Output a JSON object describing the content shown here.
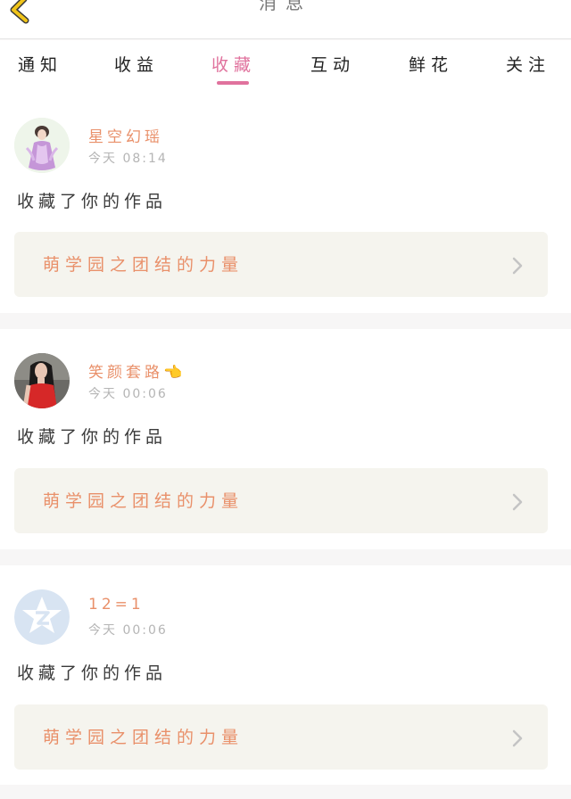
{
  "header": {
    "title": "消息",
    "back_icon": "chevron-left-icon",
    "accent_color": "#f0c419"
  },
  "tabs": [
    {
      "label": "通知",
      "active": false
    },
    {
      "label": "收益",
      "active": false
    },
    {
      "label": "收藏",
      "active": true
    },
    {
      "label": "互动",
      "active": false
    },
    {
      "label": "鲜花",
      "active": false
    },
    {
      "label": "关注",
      "active": false
    }
  ],
  "colors": {
    "active_tab": "#e0729d",
    "username": "#e9906a",
    "work_title": "#e9906a",
    "work_box_bg": "#f5f4ee"
  },
  "notifications": [
    {
      "username": "星空幻瑶",
      "time": "今天 08:14",
      "action": "收藏了你的作品",
      "work_title": "萌学园之团结的力量",
      "avatar_icon": "avatar-fairy-girl"
    },
    {
      "username": "笑颜套路👈",
      "time": "今天 00:06",
      "action": "收藏了你的作品",
      "work_title": "萌学园之团结的力量",
      "avatar_icon": "avatar-girl-red-dress"
    },
    {
      "username": "12=1",
      "time": "今天 00:06",
      "action": "收藏了你的作品",
      "work_title": "萌学园之团结的力量",
      "avatar_icon": "avatar-qzone-default"
    }
  ]
}
